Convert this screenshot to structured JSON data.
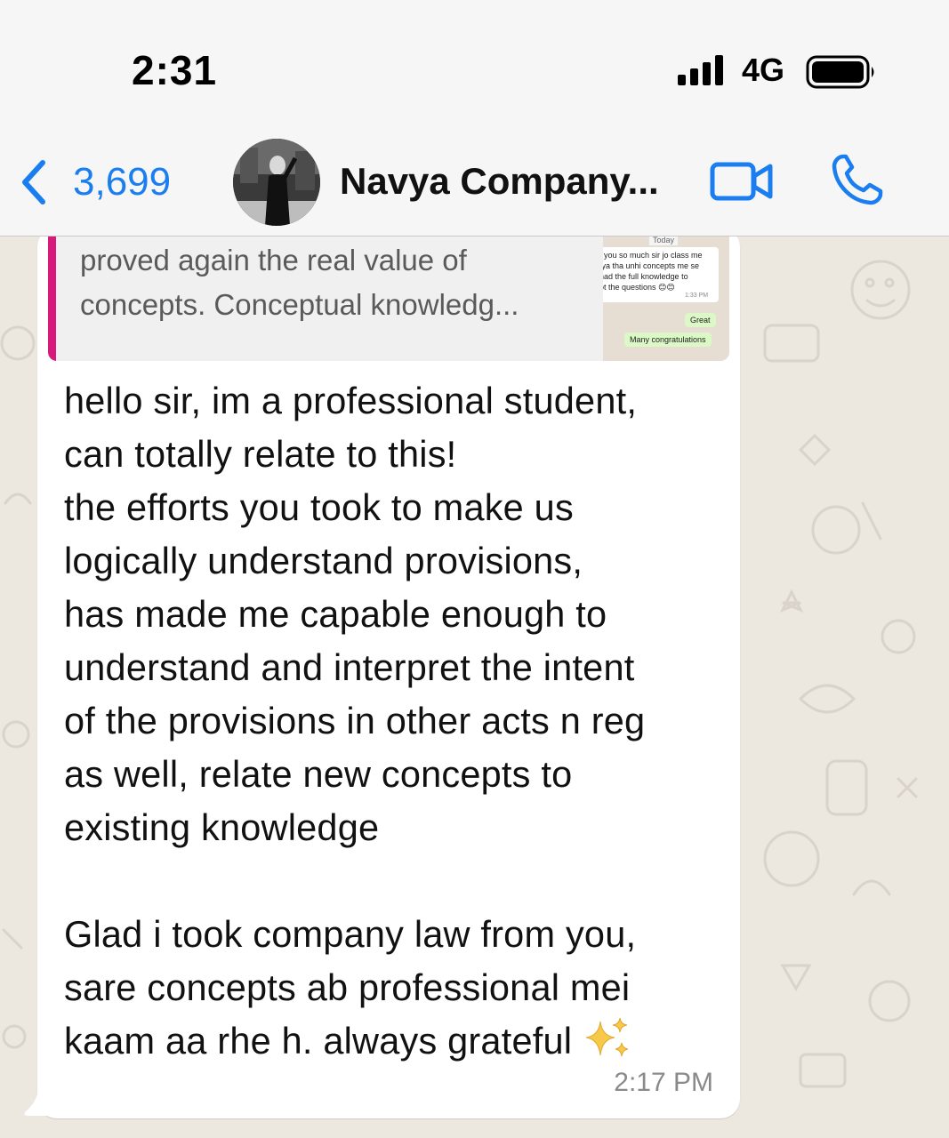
{
  "status_bar": {
    "time": "2:31",
    "network": "4G",
    "signal_icon": "cellular-signal-icon",
    "battery_icon": "battery-icon"
  },
  "header": {
    "back_icon": "chevron-left-icon",
    "unread_count": "3,699",
    "contact_name": "Navya Company...",
    "video_call_icon": "video-camera-icon",
    "voice_call_icon": "phone-icon",
    "accent_color": "#1a7ef0"
  },
  "quoted_message": {
    "lines": [
      "proved again the real value of",
      "concepts. Conceptual knowledg..."
    ],
    "accent_color": "#d6197a",
    "thumbnail": {
      "date_chip": "Today",
      "incoming_lines": [
        ": you so much sir jo class me",
        "ıya tha unhi concepts me se",
        "had the full knowledge to",
        "pt the questions 😊😊"
      ],
      "incoming_time": "1:33 PM",
      "outgoing_1": "Great",
      "outgoing_2": "Many congratulations"
    }
  },
  "message": {
    "lines": [
      "hello sir, im a professional student,",
      "can totally relate to this!",
      "the efforts you took to make us",
      "logically understand provisions,",
      "has made me capable enough to",
      "understand and interpret the intent",
      "of the provisions in other acts n reg",
      "as well, relate new concepts to",
      "existing knowledge",
      "",
      "Glad i took company law from you,",
      "sare concepts ab professional mei",
      "kaam aa rhe h. always grateful"
    ],
    "emoji_icon": "sparkles-icon",
    "time": "2:17 PM"
  }
}
